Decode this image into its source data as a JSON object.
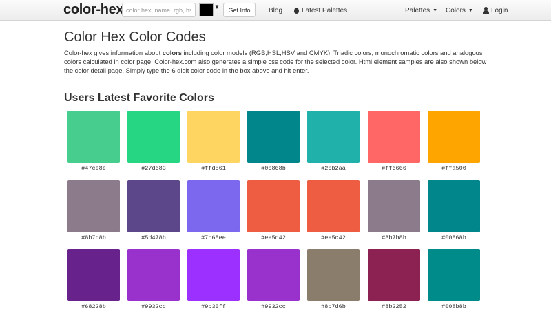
{
  "nav": {
    "brand": "color-hex",
    "search_placeholder": "color hex, name, rgb, hsl",
    "get_info": "Get Info",
    "blog": "Blog",
    "latest_palettes": "Latest Palettes",
    "palettes": "Palettes",
    "colors": "Colors",
    "login": "Login",
    "picker_color": "#000000"
  },
  "main": {
    "title": "Color Hex Color Codes",
    "intro_pre": "Color-hex gives information about ",
    "intro_bold": "colors",
    "intro_post": " including color models (RGB,HSL,HSV and CMYK), Triadic colors, monochromatic colors and analogous colors calculated in color page. Color-hex.com also generates a simple css code for the selected color. Html element samples are also shown below the color detail page. Simply type the 6 digit color code in the box above and hit enter.",
    "section_title": "Users Latest Favorite Colors"
  },
  "favorites": [
    [
      "#47ce8e",
      "#27d683",
      "#ffd561",
      "#00868b",
      "#20b2aa",
      "#ff6666",
      "#ffa500"
    ],
    [
      "#8b7b8b",
      "#5d478b",
      "#7b68ee",
      "#ee5c42",
      "#ee5c42",
      "#8b7b8b",
      "#00868b"
    ],
    [
      "#68228b",
      "#9932cc",
      "#9b30ff",
      "#9932cc",
      "#8b7d6b",
      "#8b2252",
      "#008b8b"
    ]
  ]
}
